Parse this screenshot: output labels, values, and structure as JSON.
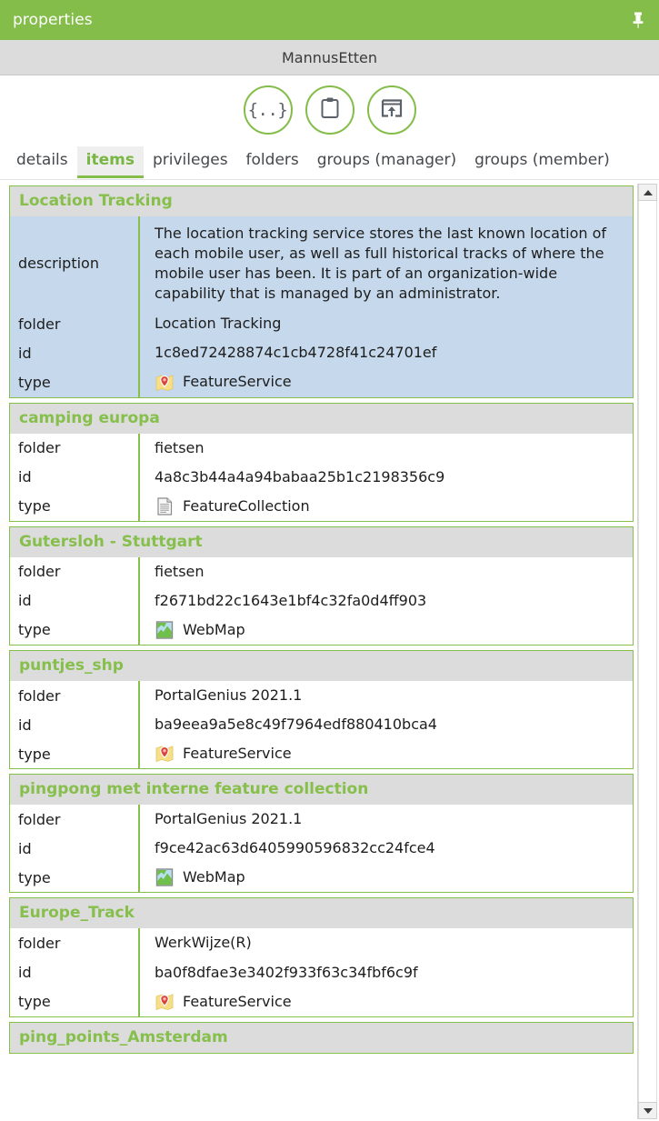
{
  "window": {
    "title": "properties",
    "pin_icon": "pushpin-icon",
    "subtitle": "MannusEtten"
  },
  "actions": [
    {
      "name": "json-button",
      "glyph": "{..}",
      "label": "json"
    },
    {
      "name": "clipboard-button",
      "glyph": "",
      "label": "clipboard"
    },
    {
      "name": "export-button",
      "glyph": "",
      "label": "export"
    }
  ],
  "tabs": [
    {
      "label": "details",
      "active": false
    },
    {
      "label": "items",
      "active": true
    },
    {
      "label": "privileges",
      "active": false
    },
    {
      "label": "folders",
      "active": false
    },
    {
      "label": "groups (manager)",
      "active": false
    },
    {
      "label": "groups (member)",
      "active": false
    }
  ],
  "labels": {
    "description": "description",
    "folder": "folder",
    "id": "id",
    "type": "type"
  },
  "colors": {
    "accent_green": "#84bd49",
    "title_green": "#86bf4b",
    "header_grey": "#dcdcdc",
    "selected_blue": "#c6d9ec"
  },
  "items": [
    {
      "title": "Location Tracking",
      "selected": true,
      "description": "The location tracking service stores the last known location of each mobile user, as well as full historical tracks of where the mobile user has been. It is part of an organization-wide capability that is managed by an administrator.",
      "folder": "Location Tracking",
      "id": "1c8ed72428874c1cb4728f41c24701ef",
      "type": "FeatureService",
      "type_icon": "map-pin-icon"
    },
    {
      "title": "camping europa",
      "selected": false,
      "description": null,
      "folder": "fietsen",
      "id": "4a8c3b44a4a94babaa25b1c2198356c9",
      "type": "FeatureCollection",
      "type_icon": "document-icon"
    },
    {
      "title": "Gutersloh - Stuttgart",
      "selected": false,
      "description": null,
      "folder": "fietsen",
      "id": "f2671bd22c1643e1bf4c32fa0d4ff903",
      "type": "WebMap",
      "type_icon": "webmap-icon"
    },
    {
      "title": "puntjes_shp",
      "selected": false,
      "description": null,
      "folder": "PortalGenius 2021.1",
      "id": "ba9eea9a5e8c49f7964edf880410bca4",
      "type": "FeatureService",
      "type_icon": "map-pin-icon"
    },
    {
      "title": "pingpong met interne feature collection",
      "selected": false,
      "description": null,
      "folder": "PortalGenius 2021.1",
      "id": "f9ce42ac63d6405990596832cc24fce4",
      "type": "WebMap",
      "type_icon": "webmap-icon"
    },
    {
      "title": "Europe_Track",
      "selected": false,
      "description": null,
      "folder": "WerkWijze(R)",
      "id": "ba0f8dfae3e3402f933f63c34fbf6c9f",
      "type": "FeatureService",
      "type_icon": "map-pin-icon"
    },
    {
      "title": "ping_points_Amsterdam",
      "selected": false,
      "description": null,
      "folder": null,
      "id": null,
      "type": null,
      "type_icon": null
    }
  ],
  "scrollbar": {
    "up_arrow": "scroll-up-icon",
    "down_arrow": "scroll-down-icon"
  }
}
